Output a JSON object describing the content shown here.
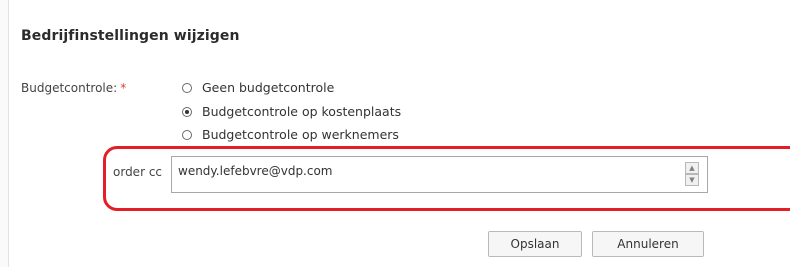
{
  "form": {
    "title": "Bedrijfinstellingen wijzigen",
    "budget_label": "Budgetcontrole:",
    "required_marker": "*",
    "options": [
      {
        "label": "Geen budgetcontrole",
        "checked": false
      },
      {
        "label": "Budgetcontrole op kostenplaats",
        "checked": true
      },
      {
        "label": "Budgetcontrole op werknemers",
        "checked": false
      }
    ],
    "cc_label": "order cc",
    "cc_value": "wendy.lefebvre@vdp.com",
    "save_label": "Opslaan",
    "cancel_label": "Annuleren"
  },
  "icons": {
    "scroll_up": "scroll-up-arrow",
    "scroll_down": "scroll-down-arrow"
  },
  "colors": {
    "highlight": "#e41e26",
    "required": "#e03a3a"
  }
}
